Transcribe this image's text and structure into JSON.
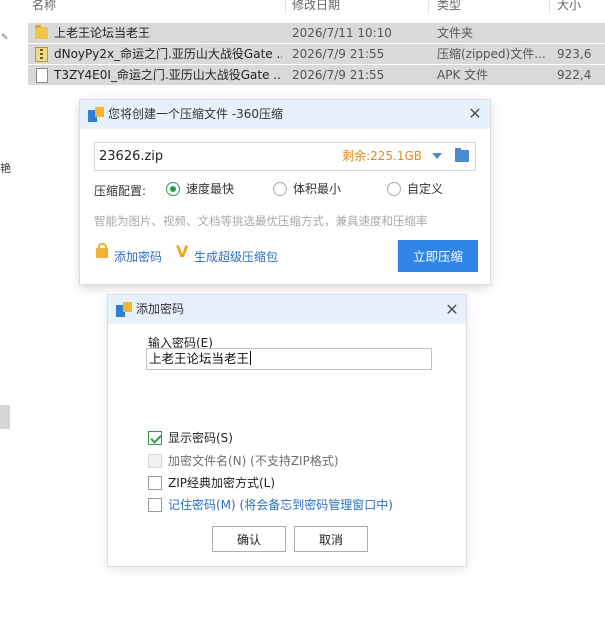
{
  "left_edge": {
    "glyph": "艳"
  },
  "explorer": {
    "columns": [
      "名称",
      "修改日期",
      "类型",
      "大小"
    ],
    "files": [
      {
        "icon": "folder-icon",
        "name": "上老王论坛当老王",
        "date": "2026/7/11 10:10",
        "type": "文件夹",
        "size": ""
      },
      {
        "icon": "zip-file-icon",
        "name": "dNoyPy2x_命运之门.亚历山大战役Gate ...",
        "date": "2026/7/9 21:55",
        "type": "压缩(zipped)文件...",
        "size": "923,6"
      },
      {
        "icon": "apk-file-icon",
        "name": "T3ZY4E0I_命运之门.亚历山大战役Gate ...",
        "date": "2026/7/9 21:55",
        "type": "APK 文件",
        "size": "922,4"
      }
    ]
  },
  "compress_panel": {
    "title": "您将创建一个压缩文件 -360压缩",
    "filename": "23626.zip",
    "free_space": "剩余:225.1GB",
    "mode_label": "压缩配置:",
    "modes": [
      {
        "label": "速度最快",
        "selected": true
      },
      {
        "label": "体积最小",
        "selected": false
      },
      {
        "label": "自定义",
        "selected": false
      }
    ],
    "hint": "智能为图片、视频、文档等挑选最优压缩方式，兼具速度和压缩率",
    "add_password_label": "添加密码",
    "super_pack_label": "生成超级压缩包",
    "compress_button": "立即压缩"
  },
  "password_dialog": {
    "title": "添加密码",
    "input_label": "输入密码(E)",
    "password_value": "上老王论坛当老王",
    "options": [
      {
        "label": "显示密码(S)",
        "checked": true,
        "disabled": false
      },
      {
        "label": "加密文件名(N) (不支持ZIP格式)",
        "checked": false,
        "disabled": true
      },
      {
        "label": "ZIP经典加密方式(L)",
        "checked": false,
        "disabled": false
      },
      {
        "label": "记住密码(M) (将会备忘到密码管理窗口中)",
        "checked": false,
        "disabled": false
      }
    ],
    "ok_button": "确认",
    "cancel_button": "取消"
  },
  "colors": {
    "accent_blue": "#2f86e6",
    "selection_gray": "#d9d9d9",
    "check_green": "#2e9a4f",
    "free_space_orange": "#e38b1a",
    "titlebar_blue": "#e7f1fb"
  }
}
